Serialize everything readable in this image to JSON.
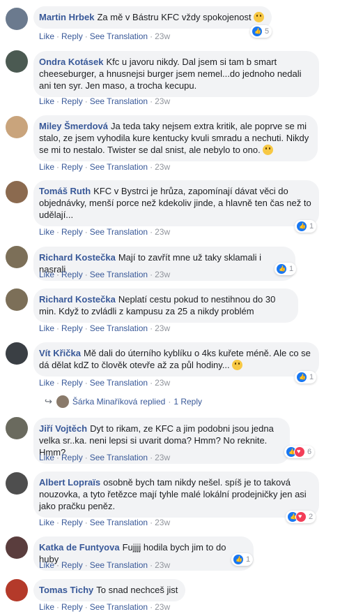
{
  "actions": {
    "like": "Like",
    "reply": "Reply",
    "translate": "See Translation",
    "sep": "·"
  },
  "comments": [
    {
      "author": "Martin Hrbek",
      "text": "Za mě v Bástru KFC vždy spokojenost",
      "emoji": "slightly-smiling-emoji",
      "time": "23w",
      "reactions": [
        "like"
      ],
      "count": "5",
      "avatar_color": "#6b7a8e"
    },
    {
      "author": "Ondra Kotásek",
      "text": "Kfc u javoru nikdy. Dal jsem si tam b smart cheeseburger, a hnusnejsi burger jsem nemel...do jednoho nedali ani ten syr. Jen maso, a trocha kecupu.",
      "time": "23w",
      "avatar_color": "#4b5a52"
    },
    {
      "author": "Miley Šmerdová",
      "text": "Ja teda taky nejsem extra kritik, ale poprve se mi stalo, ze jsem vyhodila kure kentucky kvuli smradu a nechuti. Nikdy se mi to nestalo. Twister se dal snist, ale nebylo to ono.",
      "emoji": "confused-emoji",
      "time": "23w",
      "avatar_color": "#c9a47c"
    },
    {
      "author": "Tomáš Ruth",
      "text": "KFC v Bystrci je hrůza, zapomínají dávat věci do objednávky, menší porce než kdekoliv jinde, a hlavně ten čas než to udělají...",
      "time": "23w",
      "reactions": [
        "like"
      ],
      "count": "1",
      "avatar_color": "#8b6a4f"
    },
    {
      "author": "Richard Kostečka",
      "text": "Mají to zavřít mne už taky sklamali i nasrali",
      "time": "23w",
      "reactions": [
        "like"
      ],
      "count": "1",
      "avatar_color": "#7c6f58"
    },
    {
      "author": "Richard Kostečka",
      "text": "Neplatí cestu pokud to nestihnou do 30 min. Když to zvládli z kampusu za 25 a nikdy problém",
      "time": "23w",
      "avatar_color": "#7c6f58"
    },
    {
      "author": "Vít Křička",
      "text": "Mě dali do úterního kyblíku o 4ks kuřete méně. Ale co se dá dělat kdZ to člověk otevře až za půl hodiny...",
      "emoji": "grinning-emoji",
      "time": "23w",
      "reactions": [
        "like"
      ],
      "count": "1",
      "avatar_color": "#3a3f44",
      "reply": {
        "name": "Šárka Minaříková",
        "replied": "replied",
        "count": "1 Reply"
      }
    },
    {
      "author": "Jiří Vojtěch",
      "text": "Dyt to rikam, ze KFC a jim podobni jsou jedna velka sr..ka. neni lepsi si uvarit doma? Hmm? No reknite. Hmm?",
      "time": "23w",
      "reactions": [
        "like",
        "love"
      ],
      "count": "6",
      "avatar_color": "#6a6a5e"
    },
    {
      "author": "Albert Lopraïs",
      "text": "osobně bych tam nikdy nešel. spíš je to taková nouzovka, a tyto řetězce mají tyhle malé lokální prodejničky jen asi jako pračku peněz.",
      "time": "23w",
      "reactions": [
        "like",
        "love"
      ],
      "count": "2",
      "avatar_color": "#4e4e4e"
    },
    {
      "author": "Katka de Funtyova",
      "text": "Fujjjj hodila bych jim to do huby",
      "time": "23w",
      "reactions": [
        "like"
      ],
      "count": "1",
      "avatar_color": "#5a3d3d"
    },
    {
      "author": "Tomas Tichy",
      "text": "To snad nechceš jist",
      "time": "23w",
      "avatar_color": "#b43a2a"
    }
  ]
}
